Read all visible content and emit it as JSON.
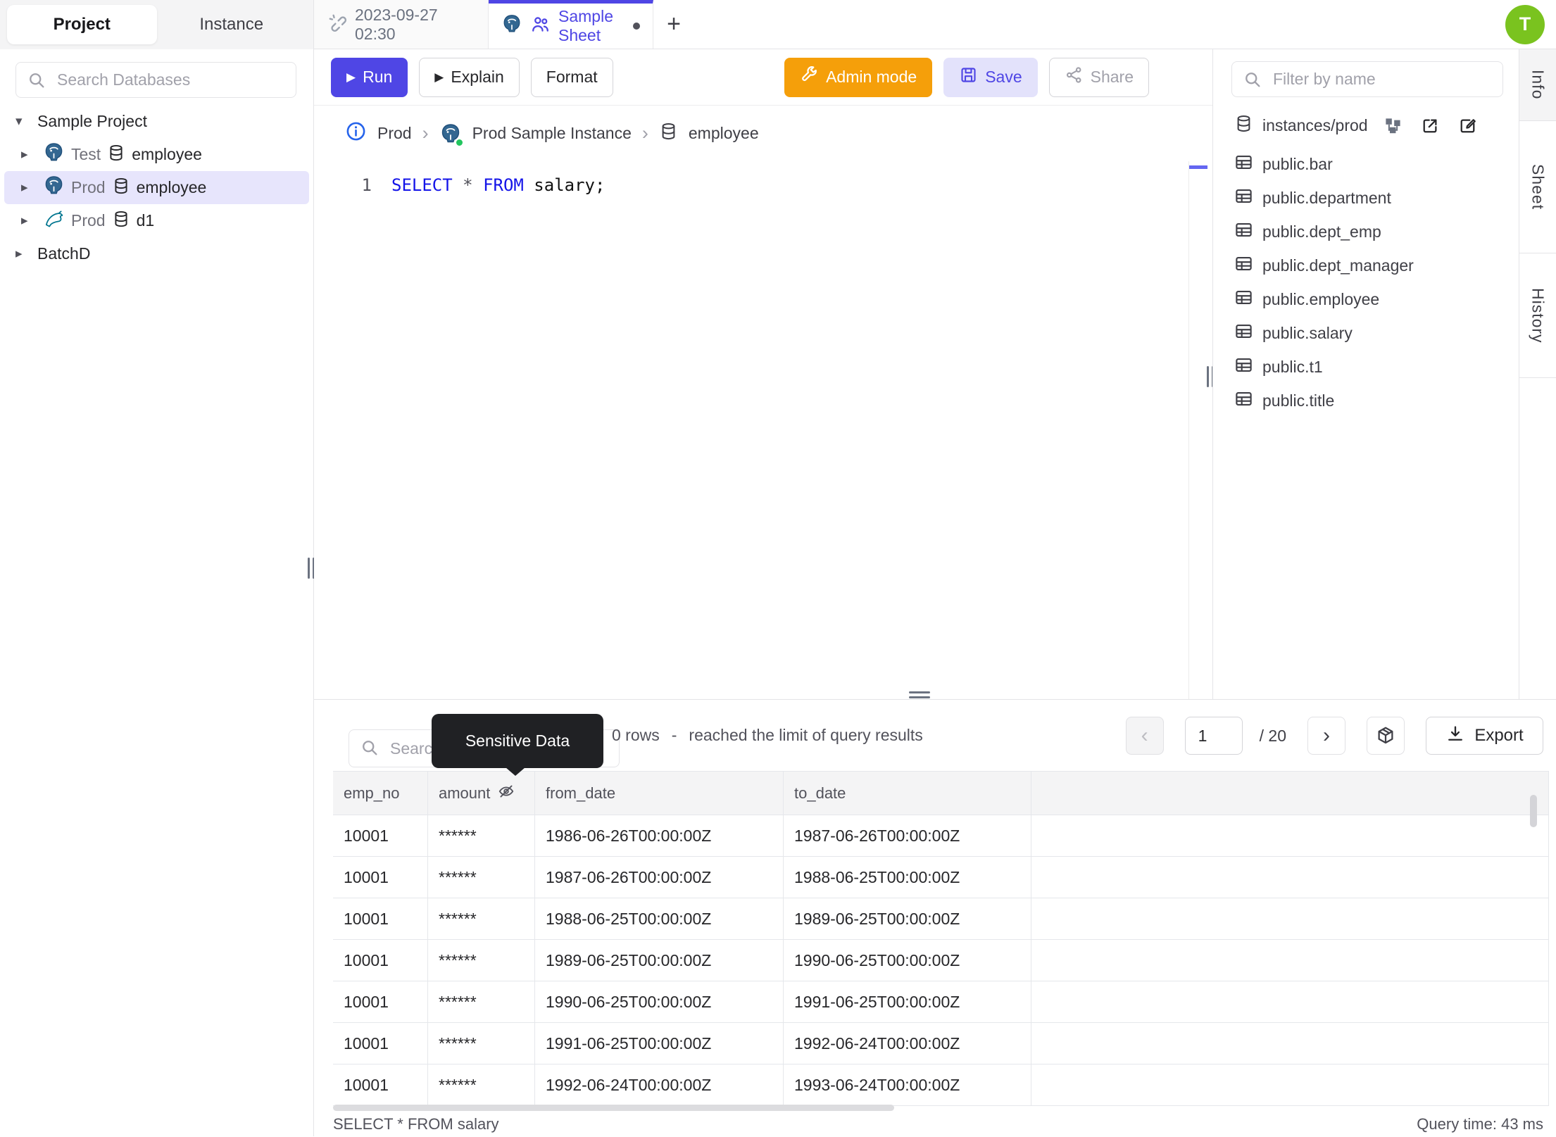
{
  "colors": {
    "accent": "#4f46e5",
    "admin_orange": "#f59f0a",
    "save_bg": "#e3e2fb",
    "selected_row_bg": "#e7e5fc",
    "avatar_green": "#7ac31f",
    "masked_tooltip_bg": "#202124",
    "status_green": "#22c55e",
    "keyword_blue": "#1414e8"
  },
  "icons": {
    "plus": "+",
    "prev": "‹",
    "next": "›",
    "play": "▶",
    "breadcrumb_sep": "›"
  },
  "sidebar": {
    "tabs": {
      "project": "Project",
      "instance": "Instance"
    },
    "search_placeholder": "Search Databases",
    "tree": [
      {
        "caret": "▾",
        "label": "Sample Project"
      },
      {
        "caret": "▸",
        "env": "Test",
        "db": "employee"
      },
      {
        "caret": "▸",
        "env": "Prod",
        "db": "employee"
      },
      {
        "caret": "▸",
        "env": "Prod",
        "db": "d1"
      },
      {
        "caret": "▸",
        "label": "BatchD"
      }
    ]
  },
  "tabbar": {
    "sheet1": "2023-09-27 02:30",
    "sheet2": "Sample Sheet",
    "avatar": "T"
  },
  "toolbar": {
    "run": "Run",
    "explain": "Explain",
    "format": "Format",
    "admin": "Admin mode",
    "save": "Save",
    "share": "Share"
  },
  "breadcrumb": {
    "env": "Prod",
    "instance": "Prod Sample Instance",
    "database": "employee"
  },
  "editor": {
    "line_number": "1",
    "kw1": "SELECT",
    "op": " * ",
    "kw2": "FROM",
    "rest": " salary;"
  },
  "schema_panel": {
    "filter_placeholder": "Filter by name",
    "path": "instances/prod",
    "tables": [
      "public.bar",
      "public.department",
      "public.dept_emp",
      "public.dept_manager",
      "public.employee",
      "public.salary",
      "public.t1",
      "public.title"
    ]
  },
  "side_strip": {
    "tabs": [
      "Info",
      "Sheet",
      "History"
    ]
  },
  "results": {
    "search_placeholder": "Search",
    "tooltip": "Sensitive Data",
    "row_count": "0 rows",
    "separator": "-",
    "limit_message": "reached the limit of query results",
    "pagination": {
      "page": "1",
      "total": "/ 20"
    },
    "export_label": "Export",
    "table": {
      "columns": [
        "emp_no",
        "amount",
        "from_date",
        "to_date"
      ],
      "masked_column": "amount",
      "rows": [
        [
          "10001",
          "******",
          "1986-06-26T00:00:00Z",
          "1987-06-26T00:00:00Z"
        ],
        [
          "10001",
          "******",
          "1987-06-26T00:00:00Z",
          "1988-06-25T00:00:00Z"
        ],
        [
          "10001",
          "******",
          "1988-06-25T00:00:00Z",
          "1989-06-25T00:00:00Z"
        ],
        [
          "10001",
          "******",
          "1989-06-25T00:00:00Z",
          "1990-06-25T00:00:00Z"
        ],
        [
          "10001",
          "******",
          "1990-06-25T00:00:00Z",
          "1991-06-25T00:00:00Z"
        ],
        [
          "10001",
          "******",
          "1991-06-25T00:00:00Z",
          "1992-06-24T00:00:00Z"
        ],
        [
          "10001",
          "******",
          "1992-06-24T00:00:00Z",
          "1993-06-24T00:00:00Z"
        ]
      ]
    },
    "status": {
      "query": "SELECT * FROM salary",
      "time": "Query time: 43 ms"
    }
  }
}
